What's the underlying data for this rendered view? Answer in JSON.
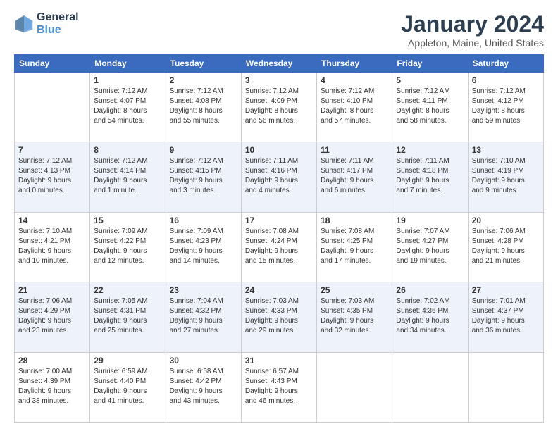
{
  "logo": {
    "line1": "General",
    "line2": "Blue"
  },
  "title": "January 2024",
  "subtitle": "Appleton, Maine, United States",
  "days_header": [
    "Sunday",
    "Monday",
    "Tuesday",
    "Wednesday",
    "Thursday",
    "Friday",
    "Saturday"
  ],
  "weeks": [
    [
      {
        "day": "",
        "info": ""
      },
      {
        "day": "1",
        "info": "Sunrise: 7:12 AM\nSunset: 4:07 PM\nDaylight: 8 hours\nand 54 minutes."
      },
      {
        "day": "2",
        "info": "Sunrise: 7:12 AM\nSunset: 4:08 PM\nDaylight: 8 hours\nand 55 minutes."
      },
      {
        "day": "3",
        "info": "Sunrise: 7:12 AM\nSunset: 4:09 PM\nDaylight: 8 hours\nand 56 minutes."
      },
      {
        "day": "4",
        "info": "Sunrise: 7:12 AM\nSunset: 4:10 PM\nDaylight: 8 hours\nand 57 minutes."
      },
      {
        "day": "5",
        "info": "Sunrise: 7:12 AM\nSunset: 4:11 PM\nDaylight: 8 hours\nand 58 minutes."
      },
      {
        "day": "6",
        "info": "Sunrise: 7:12 AM\nSunset: 4:12 PM\nDaylight: 8 hours\nand 59 minutes."
      }
    ],
    [
      {
        "day": "7",
        "info": "Sunrise: 7:12 AM\nSunset: 4:13 PM\nDaylight: 9 hours\nand 0 minutes."
      },
      {
        "day": "8",
        "info": "Sunrise: 7:12 AM\nSunset: 4:14 PM\nDaylight: 9 hours\nand 1 minute."
      },
      {
        "day": "9",
        "info": "Sunrise: 7:12 AM\nSunset: 4:15 PM\nDaylight: 9 hours\nand 3 minutes."
      },
      {
        "day": "10",
        "info": "Sunrise: 7:11 AM\nSunset: 4:16 PM\nDaylight: 9 hours\nand 4 minutes."
      },
      {
        "day": "11",
        "info": "Sunrise: 7:11 AM\nSunset: 4:17 PM\nDaylight: 9 hours\nand 6 minutes."
      },
      {
        "day": "12",
        "info": "Sunrise: 7:11 AM\nSunset: 4:18 PM\nDaylight: 9 hours\nand 7 minutes."
      },
      {
        "day": "13",
        "info": "Sunrise: 7:10 AM\nSunset: 4:19 PM\nDaylight: 9 hours\nand 9 minutes."
      }
    ],
    [
      {
        "day": "14",
        "info": "Sunrise: 7:10 AM\nSunset: 4:21 PM\nDaylight: 9 hours\nand 10 minutes."
      },
      {
        "day": "15",
        "info": "Sunrise: 7:09 AM\nSunset: 4:22 PM\nDaylight: 9 hours\nand 12 minutes."
      },
      {
        "day": "16",
        "info": "Sunrise: 7:09 AM\nSunset: 4:23 PM\nDaylight: 9 hours\nand 14 minutes."
      },
      {
        "day": "17",
        "info": "Sunrise: 7:08 AM\nSunset: 4:24 PM\nDaylight: 9 hours\nand 15 minutes."
      },
      {
        "day": "18",
        "info": "Sunrise: 7:08 AM\nSunset: 4:25 PM\nDaylight: 9 hours\nand 17 minutes."
      },
      {
        "day": "19",
        "info": "Sunrise: 7:07 AM\nSunset: 4:27 PM\nDaylight: 9 hours\nand 19 minutes."
      },
      {
        "day": "20",
        "info": "Sunrise: 7:06 AM\nSunset: 4:28 PM\nDaylight: 9 hours\nand 21 minutes."
      }
    ],
    [
      {
        "day": "21",
        "info": "Sunrise: 7:06 AM\nSunset: 4:29 PM\nDaylight: 9 hours\nand 23 minutes."
      },
      {
        "day": "22",
        "info": "Sunrise: 7:05 AM\nSunset: 4:31 PM\nDaylight: 9 hours\nand 25 minutes."
      },
      {
        "day": "23",
        "info": "Sunrise: 7:04 AM\nSunset: 4:32 PM\nDaylight: 9 hours\nand 27 minutes."
      },
      {
        "day": "24",
        "info": "Sunrise: 7:03 AM\nSunset: 4:33 PM\nDaylight: 9 hours\nand 29 minutes."
      },
      {
        "day": "25",
        "info": "Sunrise: 7:03 AM\nSunset: 4:35 PM\nDaylight: 9 hours\nand 32 minutes."
      },
      {
        "day": "26",
        "info": "Sunrise: 7:02 AM\nSunset: 4:36 PM\nDaylight: 9 hours\nand 34 minutes."
      },
      {
        "day": "27",
        "info": "Sunrise: 7:01 AM\nSunset: 4:37 PM\nDaylight: 9 hours\nand 36 minutes."
      }
    ],
    [
      {
        "day": "28",
        "info": "Sunrise: 7:00 AM\nSunset: 4:39 PM\nDaylight: 9 hours\nand 38 minutes."
      },
      {
        "day": "29",
        "info": "Sunrise: 6:59 AM\nSunset: 4:40 PM\nDaylight: 9 hours\nand 41 minutes."
      },
      {
        "day": "30",
        "info": "Sunrise: 6:58 AM\nSunset: 4:42 PM\nDaylight: 9 hours\nand 43 minutes."
      },
      {
        "day": "31",
        "info": "Sunrise: 6:57 AM\nSunset: 4:43 PM\nDaylight: 9 hours\nand 46 minutes."
      },
      {
        "day": "",
        "info": ""
      },
      {
        "day": "",
        "info": ""
      },
      {
        "day": "",
        "info": ""
      }
    ]
  ]
}
